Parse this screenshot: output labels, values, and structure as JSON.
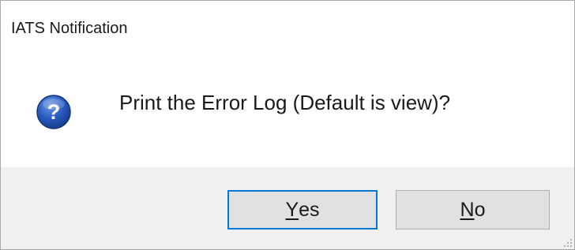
{
  "window": {
    "title": "IATS Notification"
  },
  "message": {
    "icon": "question-icon",
    "text": "Print the Error Log (Default is view)?"
  },
  "buttons": {
    "yes": {
      "mnemonic": "Y",
      "rest": "es"
    },
    "no": {
      "mnemonic": "N",
      "rest": "o"
    }
  },
  "colors": {
    "icon_blue": "#1f4ea8",
    "focus_border": "#0078d7",
    "footer_bg": "#f0f0f0",
    "button_bg": "#e1e1e1"
  }
}
